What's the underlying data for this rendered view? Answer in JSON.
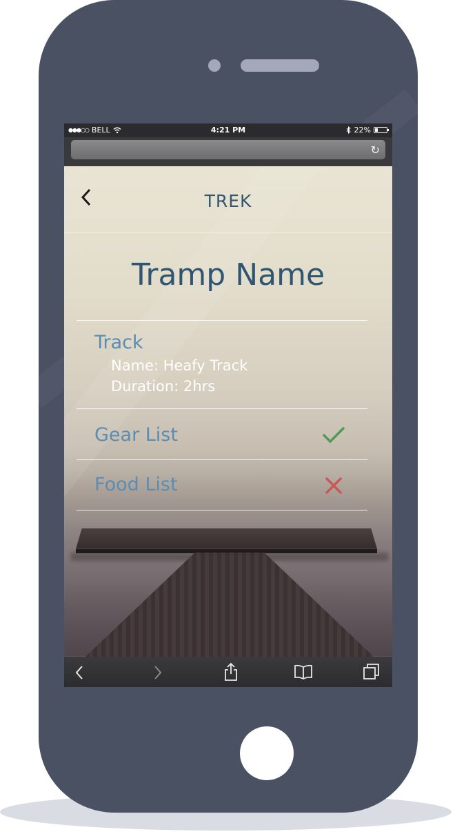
{
  "status_bar": {
    "signal": "●●●○○",
    "carrier": "BELL",
    "time": "4:21 PM",
    "battery": "22%"
  },
  "browser": {
    "url_placeholder": "",
    "toolbar_icons": [
      "back-arrow-icon",
      "forward-arrow-icon",
      "share-icon",
      "bookmarks-icon",
      "tabs-icon"
    ]
  },
  "header": {
    "title": "TREK"
  },
  "page": {
    "title": "Tramp Name"
  },
  "track": {
    "label": "Track",
    "name": "Name: Heafy Track",
    "duration": "Duration: 2hrs"
  },
  "lists": [
    {
      "label": "Gear List",
      "status": "complete",
      "icon": "checkmark-icon",
      "color": "#4f9a57"
    },
    {
      "label": "Food List",
      "status": "incomplete",
      "icon": "cross-icon",
      "color": "#c95856"
    }
  ],
  "colors": {
    "phone_body": "#4a5162",
    "title_blue": "#2f5571",
    "label_blue": "#5b8db3",
    "check_green": "#4f9a57",
    "cross_red": "#c95856"
  }
}
